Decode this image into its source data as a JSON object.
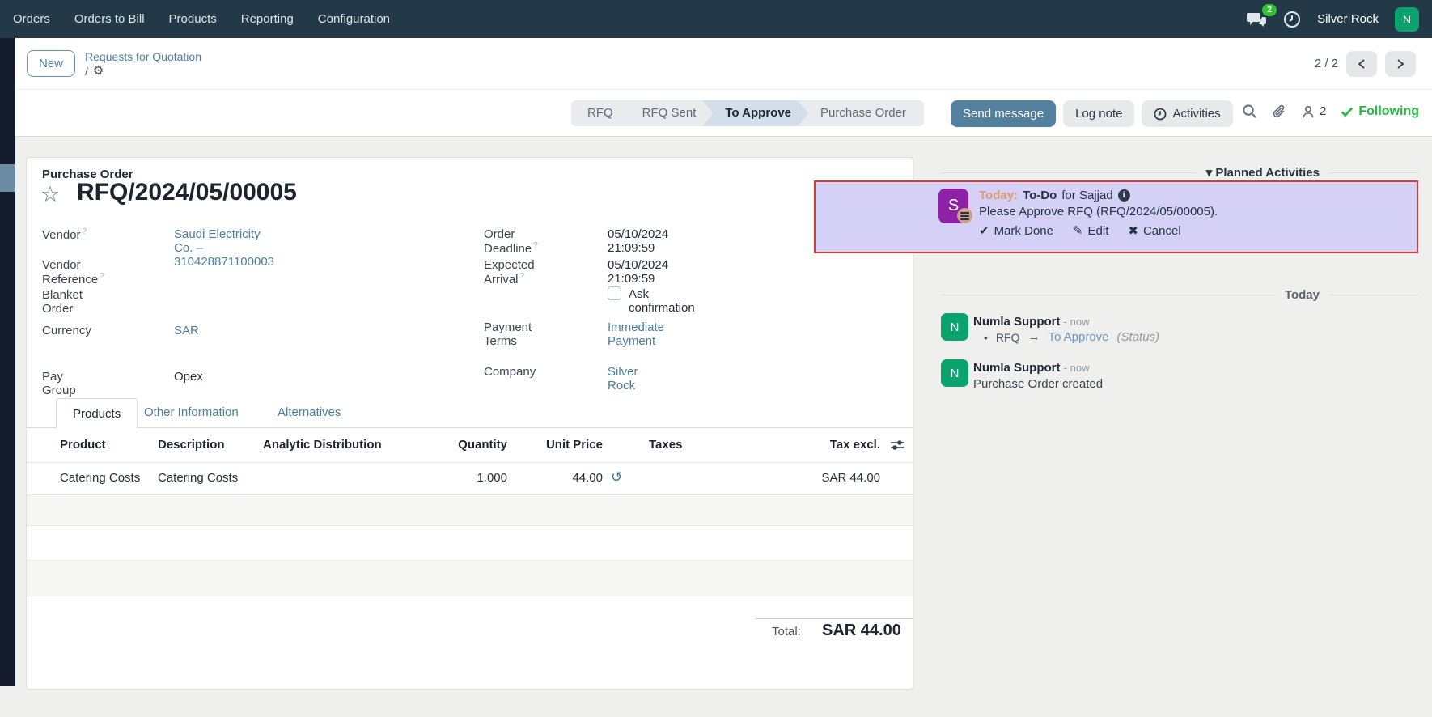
{
  "navbar": {
    "menus": [
      "Orders",
      "Orders to Bill",
      "Products",
      "Reporting",
      "Configuration"
    ],
    "messages_badge": "2",
    "company": "Silver Rock",
    "user_initial": "N"
  },
  "breadcrumb": {
    "new_button": "New",
    "parent": "Requests for Quotation",
    "separator": "/",
    "pager": "2 / 2"
  },
  "statusbar": {
    "steps": [
      "RFQ",
      "RFQ Sent",
      "To Approve",
      "Purchase Order"
    ],
    "active_step": "To Approve"
  },
  "chatter_topbar": {
    "send_message": "Send message",
    "log_note": "Log note",
    "activities": "Activities",
    "followers_count": "2",
    "following": "Following"
  },
  "form": {
    "doc_type": "Purchase Order",
    "title": "RFQ/2024/05/00005",
    "fields": {
      "vendor_label": "Vendor",
      "vendor_value": "Saudi Electricity Co. – 310428871100003",
      "vendor_ref_label": "Vendor Reference",
      "blanket_label": "Blanket Order",
      "currency_label": "Currency",
      "currency_value": "SAR",
      "pay_group_label": "Pay Group",
      "pay_group_value": "Opex",
      "deadline_label": "Order Deadline",
      "deadline_value": "05/10/2024 21:09:59",
      "arrival_label": "Expected Arrival",
      "arrival_value": "05/10/2024 21:09:59",
      "ask_confirmation_label": "Ask confirmation",
      "payment_terms_label": "Payment Terms",
      "payment_terms_value": "Immediate Payment",
      "company_label": "Company",
      "company_value": "Silver Rock"
    },
    "tabs": [
      "Products",
      "Other Information",
      "Alternatives"
    ],
    "active_tab": "Products",
    "table": {
      "columns": [
        "Product",
        "Description",
        "Analytic Distribution",
        "Quantity",
        "Unit Price",
        "Taxes",
        "Tax excl."
      ],
      "rows": [
        {
          "product": "Catering Costs",
          "description": "Catering Costs",
          "analytic": "",
          "quantity": "1.000",
          "unit_price": "44.00",
          "taxes": "",
          "subtotal": "SAR 44.00"
        }
      ],
      "total_label": "Total:",
      "total_value": "SAR 44.00"
    }
  },
  "chatter": {
    "planned_header": "Planned Activities",
    "activity": {
      "avatar_initial": "S",
      "due": "Today:",
      "type": "To-Do",
      "assignee": "for Sajjad",
      "summary": "Please Approve RFQ (RFQ/2024/05/00005).",
      "mark_done": "Mark Done",
      "edit": "Edit",
      "cancel": "Cancel"
    },
    "date_divider": "Today",
    "messages": [
      {
        "author": "Numla Support",
        "time": "- now",
        "avatar_initial": "N",
        "tracking_from": "RFQ",
        "tracking_to": "To Approve",
        "tracking_field": "(Status)"
      },
      {
        "author": "Numla Support",
        "time": "- now",
        "avatar_initial": "N",
        "body": "Purchase Order created"
      }
    ]
  },
  "colors": {
    "navbar_bg": "#233948",
    "link": "#4d7e9c",
    "green_avatar": "#0aa36e",
    "following_green": "#28b945",
    "badge_green": "#35c135",
    "highlight_fill": "#d5d1f6",
    "highlight_border": "#d23c38",
    "activity_avatar_purple": "#8d22a7",
    "primary_button": "#54809f",
    "due_today_orange": "#dd9a76",
    "status_link_blue": "#6b94c5"
  }
}
